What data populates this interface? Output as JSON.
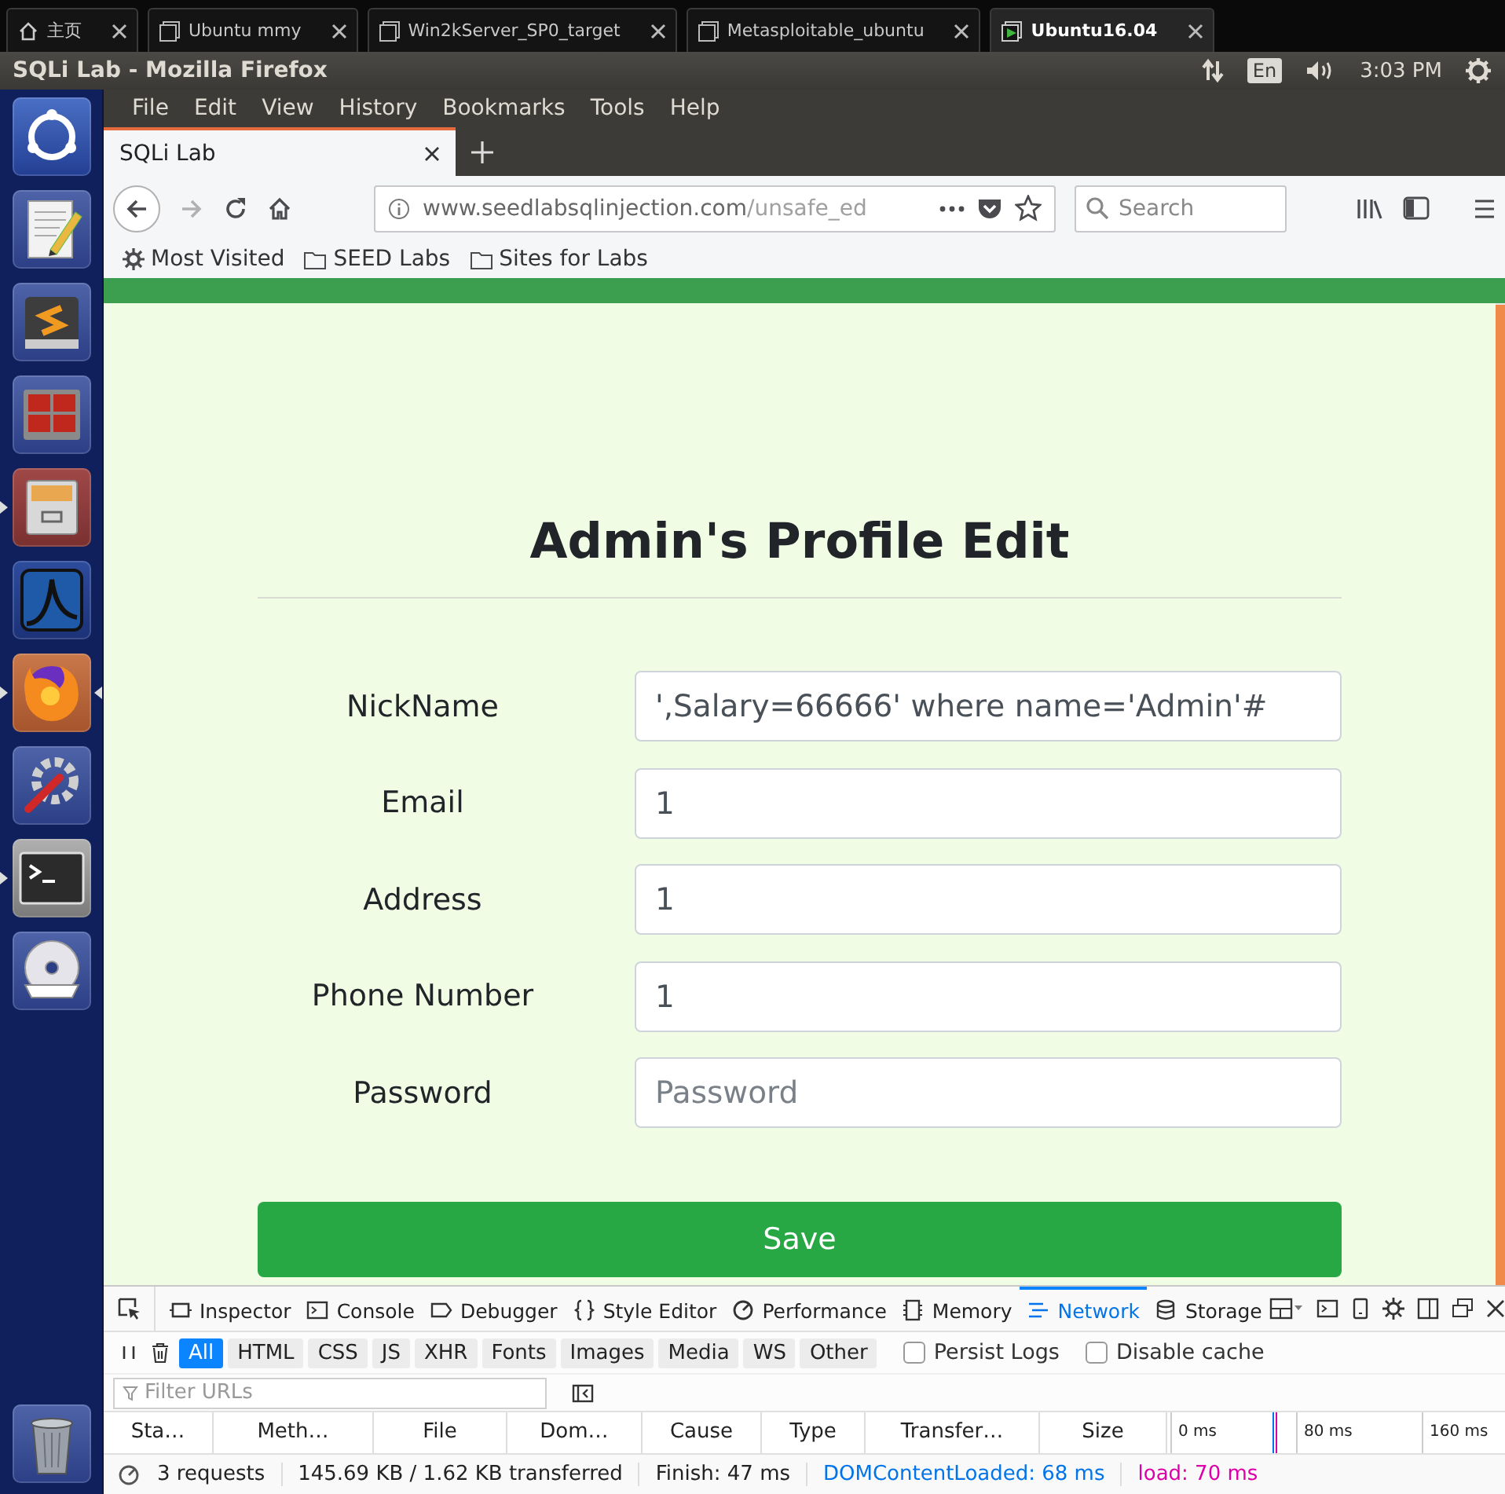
{
  "vm_tabs": [
    {
      "kind": "home",
      "label": "主页",
      "selected": false
    },
    {
      "kind": "vm",
      "label": "Ubuntu mmy",
      "selected": false
    },
    {
      "kind": "vm",
      "label": "Win2kServer_SP0_target",
      "selected": false
    },
    {
      "kind": "vm",
      "label": "Metasploitable_ubuntu",
      "selected": false
    },
    {
      "kind": "vm",
      "label": "Ubuntu16.04",
      "selected": true
    }
  ],
  "top_panel": {
    "title": "SQLi Lab - Mozilla Firefox",
    "keyboard": "En",
    "time": "3:03 PM"
  },
  "launcher": [
    {
      "kind": "dash",
      "running": false,
      "focused": false
    },
    {
      "kind": "editor",
      "running": false,
      "focused": false
    },
    {
      "kind": "sublime",
      "running": false,
      "focused": false
    },
    {
      "kind": "remote",
      "running": false,
      "focused": false
    },
    {
      "kind": "files",
      "running": true,
      "focused": false
    },
    {
      "kind": "wireshark",
      "running": false,
      "focused": false
    },
    {
      "kind": "firefox",
      "running": true,
      "focused": true
    },
    {
      "kind": "settings",
      "running": false,
      "focused": false
    },
    {
      "kind": "terminal",
      "running": true,
      "focused": false
    },
    {
      "kind": "dvd",
      "running": false,
      "focused": false
    },
    {
      "kind": "trash",
      "running": false,
      "focused": false
    }
  ],
  "menu_bar": [
    "File",
    "Edit",
    "View",
    "History",
    "Bookmarks",
    "Tools",
    "Help"
  ],
  "browser_tabs": [
    {
      "title": "SQLi Lab",
      "selected": true
    }
  ],
  "address_bar": {
    "host": "www.seedlabsqlinjection.com",
    "path": "/unsafe_ed"
  },
  "search": {
    "placeholder": "Search"
  },
  "bookmarks": [
    {
      "kind": "smart",
      "label": "Most Visited"
    },
    {
      "kind": "folder",
      "label": "SEED Labs"
    },
    {
      "kind": "folder",
      "label": "Sites for Labs"
    }
  ],
  "page": {
    "heading": "Admin's Profile Edit",
    "fields": [
      {
        "label": "NickName",
        "value": "',Salary=66666' where name='Admin'#"
      },
      {
        "label": "Email",
        "value": "1"
      },
      {
        "label": "Address",
        "value": "1"
      },
      {
        "label": "Phone Number",
        "value": "1"
      },
      {
        "label": "Password",
        "placeholder": "Password"
      }
    ],
    "save_button": "Save"
  },
  "devtools": {
    "tools": [
      {
        "kind": "inspector",
        "label": "Inspector",
        "selected": false
      },
      {
        "kind": "console",
        "label": "Console",
        "selected": false
      },
      {
        "kind": "debugger",
        "label": "Debugger",
        "selected": false
      },
      {
        "kind": "style",
        "label": "Style Editor",
        "selected": false
      },
      {
        "kind": "performance",
        "label": "Performance",
        "selected": false
      },
      {
        "kind": "memory",
        "label": "Memory",
        "selected": false
      },
      {
        "kind": "network",
        "label": "Network",
        "selected": true
      },
      {
        "kind": "storage",
        "label": "Storage",
        "selected": false
      }
    ],
    "filters": [
      {
        "label": "All",
        "selected": true
      },
      {
        "label": "HTML",
        "selected": false
      },
      {
        "label": "CSS",
        "selected": false
      },
      {
        "label": "JS",
        "selected": false
      },
      {
        "label": "XHR",
        "selected": false
      },
      {
        "label": "Fonts",
        "selected": false
      },
      {
        "label": "Images",
        "selected": false
      },
      {
        "label": "Media",
        "selected": false
      },
      {
        "label": "WS",
        "selected": false
      },
      {
        "label": "Other",
        "selected": false
      }
    ],
    "options": [
      {
        "label": "Persist Logs",
        "checked": false
      },
      {
        "label": "Disable cache",
        "checked": false
      }
    ],
    "filter_field": {
      "placeholder": "Filter URLs"
    },
    "columns": [
      "Sta…",
      "Meth…",
      "File",
      "Dom…",
      "Cause",
      "Type",
      "Transfer…",
      "Size"
    ],
    "timeline_ticks": [
      "0 ms",
      "80 ms",
      "160 ms"
    ],
    "summary": {
      "requests": "3 requests",
      "transferred": "145.69 KB / 1.62 KB transferred",
      "finish": "Finish: 47 ms",
      "dom_content_loaded": "DOMContentLoaded: 68 ms",
      "load": "load: 70 ms"
    }
  }
}
